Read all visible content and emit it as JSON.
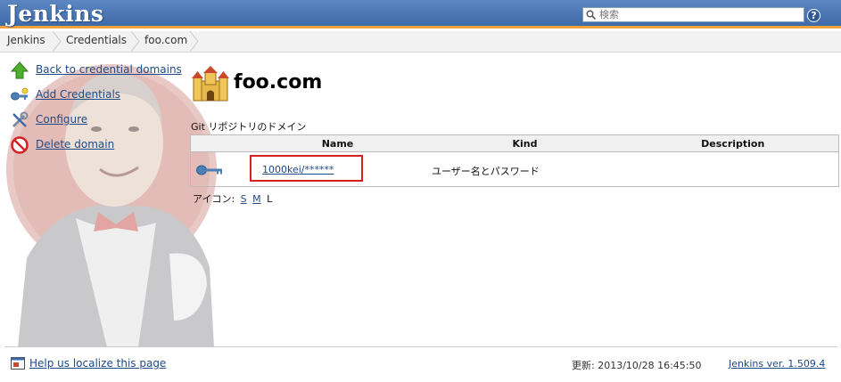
{
  "header": {
    "logo": "Jenkins",
    "search_placeholder": "検索",
    "help": "?"
  },
  "breadcrumb": [
    "Jenkins",
    "Credentials",
    "foo.com"
  ],
  "sidebar": {
    "items": [
      {
        "label": "Back to credential domains",
        "icon": "up-arrow-icon"
      },
      {
        "label": "Add Credentials",
        "icon": "key-icon"
      },
      {
        "label": "Configure",
        "icon": "wrench-icon"
      },
      {
        "label": "Delete domain",
        "icon": "no-entry-icon"
      }
    ]
  },
  "main": {
    "title": "foo.com",
    "description": "Git リポジトリのドメイン",
    "table": {
      "columns": [
        "Name",
        "Kind",
        "Description"
      ],
      "rows": [
        {
          "name": "1000kei/******",
          "kind": "ユーザー名とパスワード",
          "description": ""
        }
      ]
    },
    "icon_size": {
      "label": "アイコン:",
      "options": [
        "S",
        "M",
        "L"
      ],
      "current": "L"
    }
  },
  "footer": {
    "localize": "Help us localize this page",
    "updated": "更新: 2013/10/28 16:45:50",
    "version": "Jenkins ver. 1.509.4"
  },
  "colors": {
    "header_blue": "#4a78b8",
    "header_accent": "#f2a23a",
    "link": "#204a87",
    "highlight": "#d42020"
  }
}
